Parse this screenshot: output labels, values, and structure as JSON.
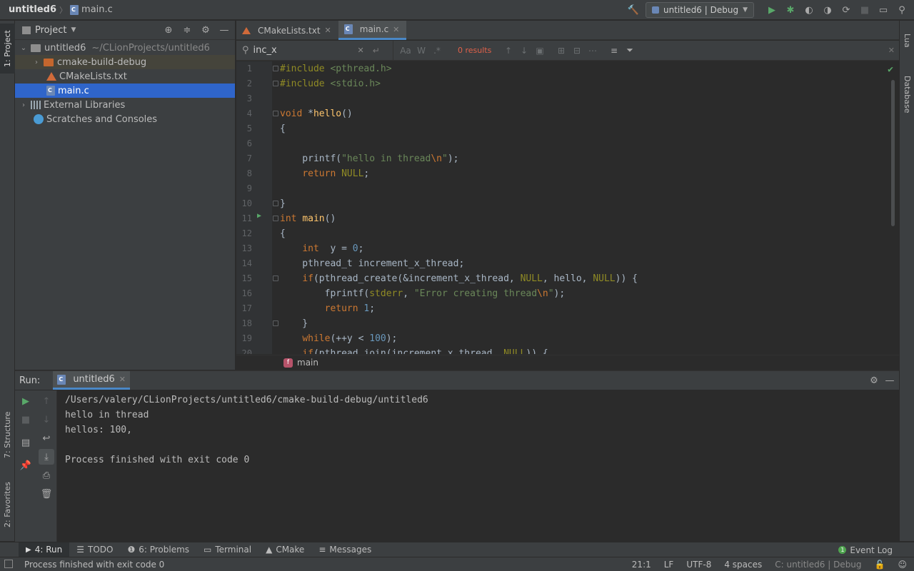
{
  "navbar": {
    "project": "untitled6",
    "file": "main.c",
    "run_config": "untitled6 | Debug"
  },
  "project_panel": {
    "title": "Project",
    "tree": [
      {
        "label": "untitled6",
        "path": "~/CLionProjects/untitled6"
      },
      {
        "label": "cmake-build-debug"
      },
      {
        "label": "CMakeLists.txt"
      },
      {
        "label": "main.c"
      },
      {
        "label": "External Libraries"
      },
      {
        "label": "Scratches and Consoles"
      }
    ]
  },
  "left_strip": {
    "project": "1: Project",
    "structure": "7: Structure",
    "favorites": "2: Favorites"
  },
  "right_strip": {
    "lua": "Lua",
    "database": "Database"
  },
  "editor": {
    "tabs": [
      {
        "label": "CMakeLists.txt"
      },
      {
        "label": "main.c"
      }
    ],
    "search": {
      "query": "inc_x",
      "results": "0 results",
      "opt_case": "Aa",
      "opt_word": "W",
      "opt_regex": ".*"
    },
    "breadcrumb": "main",
    "line_numbers": [
      "1",
      "2",
      "3",
      "4",
      "5",
      "6",
      "7",
      "8",
      "9",
      "10",
      "11",
      "12",
      "13",
      "14",
      "15",
      "16",
      "17",
      "18",
      "19",
      "20"
    ]
  },
  "run_panel": {
    "label": "Run:",
    "tab": "untitled6",
    "console": [
      "/Users/valery/CLionProjects/untitled6/cmake-build-debug/untitled6",
      "hello in thread",
      "hellos: 100,",
      "",
      "Process finished with exit code 0"
    ]
  },
  "bottom_bar": {
    "tabs": [
      {
        "label": "4: Run"
      },
      {
        "label": "TODO"
      },
      {
        "label": "6: Problems"
      },
      {
        "label": "Terminal"
      },
      {
        "label": "CMake"
      },
      {
        "label": "Messages"
      }
    ],
    "event_log": "Event Log"
  },
  "status_bar": {
    "message": "Process finished with exit code 0",
    "position": "21:1",
    "line_sep": "LF",
    "encoding": "UTF-8",
    "indent": "4 spaces",
    "context": "C: untitled6 | Debug"
  },
  "colors": {
    "background": "#2b2b2b",
    "panel": "#3c3f41",
    "selection": "#2f65ca",
    "keyword": "#cc7832",
    "string": "#6a8759",
    "number": "#6897bb",
    "function": "#ffc66d"
  },
  "icons": [
    "hammer-icon",
    "run-icon",
    "debug-icon",
    "coverage-icon",
    "profile-icon",
    "stop-icon",
    "search-icon",
    "gear-icon",
    "locate-icon",
    "collapse-icon",
    "minimize-icon",
    "filter-icon",
    "rerun-icon",
    "print-icon",
    "trash-icon",
    "pin-icon"
  ]
}
